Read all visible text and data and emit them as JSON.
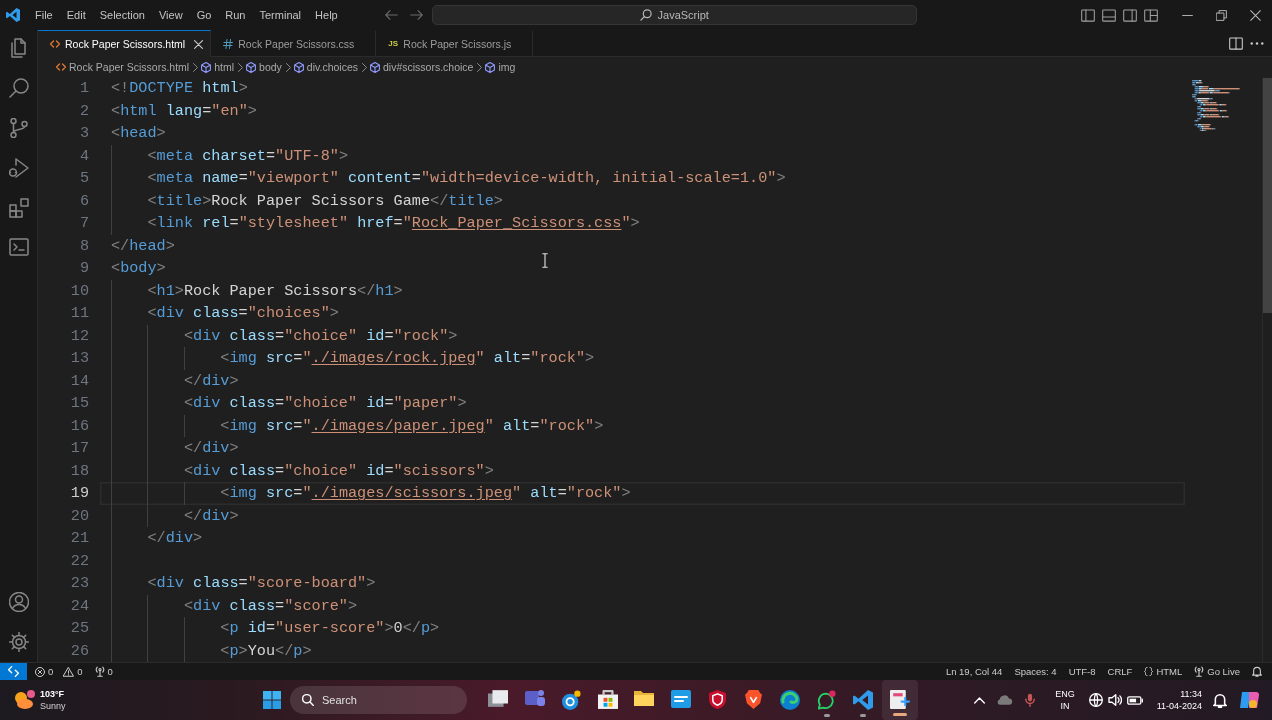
{
  "title_bar": {
    "menu": [
      "File",
      "Edit",
      "Selection",
      "View",
      "Go",
      "Run",
      "Terminal",
      "Help"
    ],
    "command_center": {
      "label": "JavaScript"
    }
  },
  "tabs": [
    {
      "label": "Rock Paper Scissors.html",
      "kind": "html",
      "selected": true
    },
    {
      "label": "Rock Paper Scissors.css",
      "kind": "css",
      "selected": false
    },
    {
      "label": "Rock Paper Scissors.js",
      "kind": "js",
      "icon_label": "JS",
      "selected": false
    }
  ],
  "breadcrumb": [
    {
      "label": "Rock Paper Scissors.html",
      "kind": "file"
    },
    {
      "label": "html",
      "kind": "element"
    },
    {
      "label": "body",
      "kind": "element"
    },
    {
      "label": "div.choices",
      "kind": "element"
    },
    {
      "label": "div#scissors.choice",
      "kind": "element"
    },
    {
      "label": "img",
      "kind": "element"
    }
  ],
  "editor": {
    "lines": [
      {
        "number": "1",
        "current": false,
        "tokens": [
          {
            "kind": "punct",
            "text": "<!"
          },
          {
            "kind": "tag",
            "text": "DOCTYPE"
          },
          {
            "kind": "attr",
            "text": " html"
          },
          {
            "kind": "punct",
            "text": ">"
          }
        ]
      },
      {
        "number": "2",
        "current": false,
        "tokens": [
          {
            "kind": "punct",
            "text": "<"
          },
          {
            "kind": "tag",
            "text": "html"
          },
          {
            "kind": "attr",
            "text": " lang"
          },
          {
            "kind": "op",
            "text": "="
          },
          {
            "kind": "string",
            "text": "\"en\""
          },
          {
            "kind": "punct",
            "text": ">"
          }
        ]
      },
      {
        "number": "3",
        "current": false,
        "tokens": [
          {
            "kind": "punct",
            "text": "<"
          },
          {
            "kind": "tag",
            "text": "head"
          },
          {
            "kind": "punct",
            "text": ">"
          }
        ],
        "children": [
          {
            "number": "4",
            "current": false,
            "tokens": [
              {
                "kind": "punct",
                "text": "<"
              },
              {
                "kind": "tag",
                "text": "meta"
              },
              {
                "kind": "attr",
                "text": " charset"
              },
              {
                "kind": "op",
                "text": "="
              },
              {
                "kind": "string",
                "text": "\"UTF-8\""
              },
              {
                "kind": "punct",
                "text": ">"
              }
            ]
          },
          {
            "number": "5",
            "current": false,
            "tokens": [
              {
                "kind": "punct",
                "text": "<"
              },
              {
                "kind": "tag",
                "text": "meta"
              },
              {
                "kind": "attr",
                "text": " name"
              },
              {
                "kind": "op",
                "text": "="
              },
              {
                "kind": "string",
                "text": "\"viewport\""
              },
              {
                "kind": "attr",
                "text": " content"
              },
              {
                "kind": "op",
                "text": "="
              },
              {
                "kind": "string",
                "text": "\"width=device-width, initial-scale=1.0\""
              },
              {
                "kind": "punct",
                "text": ">"
              }
            ]
          },
          {
            "number": "6",
            "current": false,
            "tokens": [
              {
                "kind": "punct",
                "text": "<"
              },
              {
                "kind": "tag",
                "text": "title"
              },
              {
                "kind": "punct",
                "text": ">"
              },
              {
                "kind": "text",
                "text": "Rock Paper Scissors Game"
              },
              {
                "kind": "punct",
                "text": "</"
              },
              {
                "kind": "tag",
                "text": "title"
              },
              {
                "kind": "punct",
                "text": ">"
              }
            ]
          },
          {
            "number": "7",
            "current": false,
            "tokens": [
              {
                "kind": "punct",
                "text": "<"
              },
              {
                "kind": "tag",
                "text": "link"
              },
              {
                "kind": "attr",
                "text": " rel"
              },
              {
                "kind": "op",
                "text": "="
              },
              {
                "kind": "string",
                "text": "\"stylesheet\""
              },
              {
                "kind": "attr",
                "text": " href"
              },
              {
                "kind": "op",
                "text": "="
              },
              {
                "kind": "string",
                "text": "\""
              },
              {
                "kind": "link",
                "text": "Rock_Paper_Scissors.css"
              },
              {
                "kind": "string",
                "text": "\""
              },
              {
                "kind": "punct",
                "text": ">"
              }
            ]
          }
        ]
      },
      {
        "number": "8",
        "current": false,
        "tokens": [
          {
            "kind": "punct",
            "text": "</"
          },
          {
            "kind": "tag",
            "text": "head"
          },
          {
            "kind": "punct",
            "text": ">"
          }
        ]
      },
      {
        "number": "9",
        "current": false,
        "tokens": [
          {
            "kind": "punct",
            "text": "<"
          },
          {
            "kind": "tag",
            "text": "body"
          },
          {
            "kind": "punct",
            "text": ">"
          }
        ],
        "children": [
          {
            "number": "10",
            "current": false,
            "tokens": [
              {
                "kind": "punct",
                "text": "<"
              },
              {
                "kind": "tag",
                "text": "h1"
              },
              {
                "kind": "punct",
                "text": ">"
              },
              {
                "kind": "text",
                "text": "Rock Paper Scissors"
              },
              {
                "kind": "punct",
                "text": "</"
              },
              {
                "kind": "tag",
                "text": "h1"
              },
              {
                "kind": "punct",
                "text": ">"
              }
            ]
          },
          {
            "number": "11",
            "current": false,
            "tokens": [
              {
                "kind": "punct",
                "text": "<"
              },
              {
                "kind": "tag",
                "text": "div"
              },
              {
                "kind": "attr",
                "text": " class"
              },
              {
                "kind": "op",
                "text": "="
              },
              {
                "kind": "string",
                "text": "\"choices\""
              },
              {
                "kind": "punct",
                "text": ">"
              }
            ],
            "children": [
              {
                "number": "12",
                "current": false,
                "tokens": [
                  {
                    "kind": "punct",
                    "text": "<"
                  },
                  {
                    "kind": "tag",
                    "text": "div"
                  },
                  {
                    "kind": "attr",
                    "text": " class"
                  },
                  {
                    "kind": "op",
                    "text": "="
                  },
                  {
                    "kind": "string",
                    "text": "\"choice\""
                  },
                  {
                    "kind": "attr",
                    "text": " id"
                  },
                  {
                    "kind": "op",
                    "text": "="
                  },
                  {
                    "kind": "string",
                    "text": "\"rock\""
                  },
                  {
                    "kind": "punct",
                    "text": ">"
                  }
                ],
                "children": [
                  {
                    "number": "13",
                    "current": false,
                    "tokens": [
                      {
                        "kind": "punct",
                        "text": "<"
                      },
                      {
                        "kind": "tag",
                        "text": "img"
                      },
                      {
                        "kind": "attr",
                        "text": " src"
                      },
                      {
                        "kind": "op",
                        "text": "="
                      },
                      {
                        "kind": "string",
                        "text": "\""
                      },
                      {
                        "kind": "link",
                        "text": "./images/rock.jpeg"
                      },
                      {
                        "kind": "string",
                        "text": "\""
                      },
                      {
                        "kind": "attr",
                        "text": " alt"
                      },
                      {
                        "kind": "op",
                        "text": "="
                      },
                      {
                        "kind": "string",
                        "text": "\"rock\""
                      },
                      {
                        "kind": "punct",
                        "text": ">"
                      }
                    ]
                  }
                ]
              },
              {
                "number": "14",
                "current": false,
                "tokens": [
                  {
                    "kind": "punct",
                    "text": "</"
                  },
                  {
                    "kind": "tag",
                    "text": "div"
                  },
                  {
                    "kind": "punct",
                    "text": ">"
                  }
                ]
              },
              {
                "number": "15",
                "current": false,
                "tokens": [
                  {
                    "kind": "punct",
                    "text": "<"
                  },
                  {
                    "kind": "tag",
                    "text": "div"
                  },
                  {
                    "kind": "attr",
                    "text": " class"
                  },
                  {
                    "kind": "op",
                    "text": "="
                  },
                  {
                    "kind": "string",
                    "text": "\"choice\""
                  },
                  {
                    "kind": "attr",
                    "text": " id"
                  },
                  {
                    "kind": "op",
                    "text": "="
                  },
                  {
                    "kind": "string",
                    "text": "\"paper\""
                  },
                  {
                    "kind": "punct",
                    "text": ">"
                  }
                ],
                "children": [
                  {
                    "number": "16",
                    "current": false,
                    "tokens": [
                      {
                        "kind": "punct",
                        "text": "<"
                      },
                      {
                        "kind": "tag",
                        "text": "img"
                      },
                      {
                        "kind": "attr",
                        "text": " src"
                      },
                      {
                        "kind": "op",
                        "text": "="
                      },
                      {
                        "kind": "string",
                        "text": "\""
                      },
                      {
                        "kind": "link",
                        "text": "./images/paper.jpeg"
                      },
                      {
                        "kind": "string",
                        "text": "\""
                      },
                      {
                        "kind": "attr",
                        "text": " alt"
                      },
                      {
                        "kind": "op",
                        "text": "="
                      },
                      {
                        "kind": "string",
                        "text": "\"rock\""
                      },
                      {
                        "kind": "punct",
                        "text": ">"
                      }
                    ]
                  }
                ]
              },
              {
                "number": "17",
                "current": false,
                "tokens": [
                  {
                    "kind": "punct",
                    "text": "</"
                  },
                  {
                    "kind": "tag",
                    "text": "div"
                  },
                  {
                    "kind": "punct",
                    "text": ">"
                  }
                ]
              },
              {
                "number": "18",
                "current": false,
                "tokens": [
                  {
                    "kind": "punct",
                    "text": "<"
                  },
                  {
                    "kind": "tag",
                    "text": "div"
                  },
                  {
                    "kind": "attr",
                    "text": " class"
                  },
                  {
                    "kind": "op",
                    "text": "="
                  },
                  {
                    "kind": "string",
                    "text": "\"choice\""
                  },
                  {
                    "kind": "attr",
                    "text": " id"
                  },
                  {
                    "kind": "op",
                    "text": "="
                  },
                  {
                    "kind": "string",
                    "text": "\"scissors\""
                  },
                  {
                    "kind": "punct",
                    "text": ">"
                  }
                ],
                "children": [
                  {
                    "number": "19",
                    "current": true,
                    "tokens": [
                      {
                        "kind": "punct",
                        "text": "<"
                      },
                      {
                        "kind": "tag",
                        "text": "img"
                      },
                      {
                        "kind": "attr",
                        "text": " src"
                      },
                      {
                        "kind": "op",
                        "text": "="
                      },
                      {
                        "kind": "string",
                        "text": "\""
                      },
                      {
                        "kind": "link",
                        "text": "./images/scissors.jpeg"
                      },
                      {
                        "kind": "string",
                        "text": "\""
                      },
                      {
                        "kind": "attr",
                        "text": " alt"
                      },
                      {
                        "kind": "op",
                        "text": "="
                      },
                      {
                        "kind": "string",
                        "text": "\"rock\""
                      },
                      {
                        "kind": "punct",
                        "text": ">"
                      }
                    ]
                  }
                ]
              },
              {
                "number": "20",
                "current": false,
                "tokens": [
                  {
                    "kind": "punct",
                    "text": "</"
                  },
                  {
                    "kind": "tag",
                    "text": "div"
                  },
                  {
                    "kind": "punct",
                    "text": ">"
                  }
                ]
              }
            ]
          },
          {
            "number": "21",
            "current": false,
            "tokens": [
              {
                "kind": "punct",
                "text": "</"
              },
              {
                "kind": "tag",
                "text": "div"
              },
              {
                "kind": "punct",
                "text": ">"
              }
            ]
          },
          {
            "number": "22",
            "current": false
          },
          {
            "number": "23",
            "current": false,
            "tokens": [
              {
                "kind": "punct",
                "text": "<"
              },
              {
                "kind": "tag",
                "text": "div"
              },
              {
                "kind": "attr",
                "text": " class"
              },
              {
                "kind": "op",
                "text": "="
              },
              {
                "kind": "string",
                "text": "\"score-board\""
              },
              {
                "kind": "punct",
                "text": ">"
              }
            ],
            "children": [
              {
                "number": "24",
                "current": false,
                "tokens": [
                  {
                    "kind": "punct",
                    "text": "<"
                  },
                  {
                    "kind": "tag",
                    "text": "div"
                  },
                  {
                    "kind": "attr",
                    "text": " class"
                  },
                  {
                    "kind": "op",
                    "text": "="
                  },
                  {
                    "kind": "string",
                    "text": "\"score\""
                  },
                  {
                    "kind": "punct",
                    "text": ">"
                  }
                ],
                "children": [
                  {
                    "number": "25",
                    "current": false,
                    "tokens": [
                      {
                        "kind": "punct",
                        "text": "<"
                      },
                      {
                        "kind": "tag",
                        "text": "p"
                      },
                      {
                        "kind": "attr",
                        "text": " id"
                      },
                      {
                        "kind": "op",
                        "text": "="
                      },
                      {
                        "kind": "string",
                        "text": "\"user-score\""
                      },
                      {
                        "kind": "punct",
                        "text": ">"
                      },
                      {
                        "kind": "text",
                        "text": "0"
                      },
                      {
                        "kind": "punct",
                        "text": "</"
                      },
                      {
                        "kind": "tag",
                        "text": "p"
                      },
                      {
                        "kind": "punct",
                        "text": ">"
                      }
                    ]
                  },
                  {
                    "number": "26",
                    "current": false,
                    "tokens": [
                      {
                        "kind": "punct",
                        "text": "<"
                      },
                      {
                        "kind": "tag",
                        "text": "p"
                      },
                      {
                        "kind": "punct",
                        "text": ">"
                      },
                      {
                        "kind": "text",
                        "text": "You"
                      },
                      {
                        "kind": "punct",
                        "text": "</"
                      },
                      {
                        "kind": "tag",
                        "text": "p"
                      },
                      {
                        "kind": "punct",
                        "text": ">"
                      }
                    ]
                  }
                ]
              }
            ]
          }
        ]
      }
    ]
  },
  "status_bar": {
    "errors": "0",
    "warnings": "0",
    "ports": "0",
    "cursor": "Ln 19, Col 44",
    "indentation": "Spaces: 4",
    "encoding": "UTF-8",
    "line_endings": "CRLF",
    "language": "HTML",
    "live_server": "Go Live"
  },
  "taskbar": {
    "weather": {
      "temperature": "103°F",
      "condition": "Sunny"
    },
    "search": {
      "placeholder": "Search"
    },
    "apps": [
      {
        "kind": "task-view",
        "running": false,
        "selected": false
      },
      {
        "kind": "meeting",
        "running": false,
        "selected": false
      },
      {
        "kind": "help",
        "running": false,
        "selected": false
      },
      {
        "kind": "store",
        "running": false,
        "selected": false
      },
      {
        "kind": "files",
        "running": false,
        "selected": false
      },
      {
        "kind": "tile-app",
        "running": false,
        "selected": false
      },
      {
        "kind": "security",
        "running": false,
        "selected": false
      },
      {
        "kind": "browser-shield",
        "running": false,
        "selected": false
      },
      {
        "kind": "browser-swirl",
        "running": false,
        "selected": false
      },
      {
        "kind": "messenger",
        "running": true,
        "selected": false
      },
      {
        "kind": "code-editor",
        "running": true,
        "selected": false
      },
      {
        "kind": "document-app",
        "running": true,
        "selected": true
      }
    ],
    "input_language": {
      "language": "ENG",
      "region": "IN"
    },
    "clock": {
      "time": "11:34",
      "date": "11-04-2024"
    }
  }
}
